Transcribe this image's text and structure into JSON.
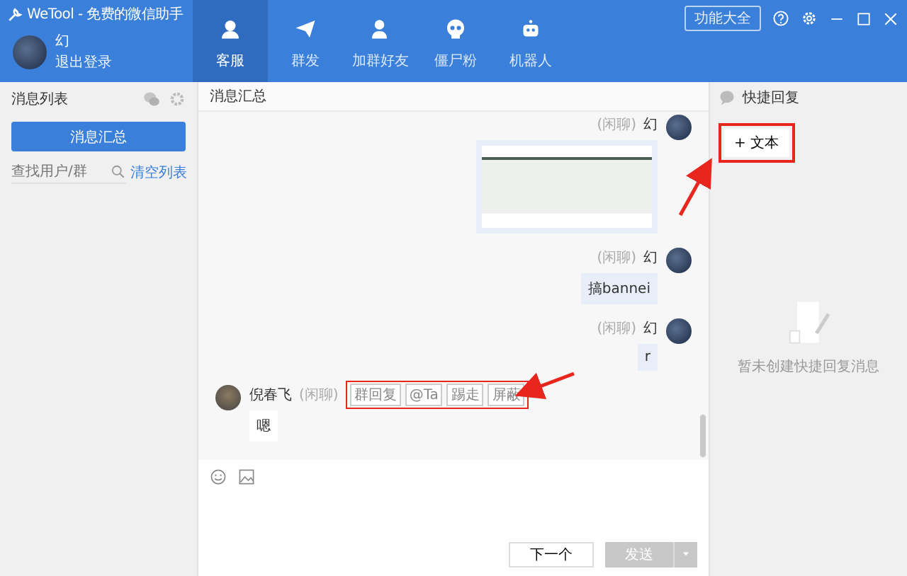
{
  "window": {
    "title": "WeTool - 免费的微信助手",
    "feature_button": "功能大全"
  },
  "account": {
    "name": "幻",
    "logout": "退出登录"
  },
  "tabs": [
    {
      "label": "客服",
      "selected": true
    },
    {
      "label": "群发",
      "selected": false
    },
    {
      "label": "加群好友",
      "selected": false
    },
    {
      "label": "僵尸粉",
      "selected": false
    },
    {
      "label": "机器人",
      "selected": false
    }
  ],
  "sidebar": {
    "title": "消息列表",
    "summary_button": "消息汇总",
    "search": {
      "placeholder": "查找用户/群"
    },
    "clear_link": "清空列表"
  },
  "chat": {
    "title": "消息汇总",
    "messages": [
      {
        "kind": "sent-image",
        "tag": "(闲聊)",
        "sender": "幻"
      },
      {
        "kind": "sent-text",
        "tag": "(闲聊)",
        "sender": "幻",
        "text": "搞bannei"
      },
      {
        "kind": "sent-text",
        "tag": "(闲聊)",
        "sender": "幻",
        "text": "r"
      },
      {
        "kind": "received-text",
        "tag": "(闲聊)",
        "sender": "倪春飞",
        "actions": [
          "群回复",
          "@Ta",
          "踢走",
          "屏蔽"
        ],
        "text": "嗯"
      }
    ],
    "compose": {
      "next_button": "下一个",
      "send_button": {
        "label": "发送",
        "disabled": true
      }
    }
  },
  "quick_reply": {
    "title": "快捷回复",
    "add_button": "+ 文本",
    "empty_text": "暂未创建快捷回复消息"
  }
}
